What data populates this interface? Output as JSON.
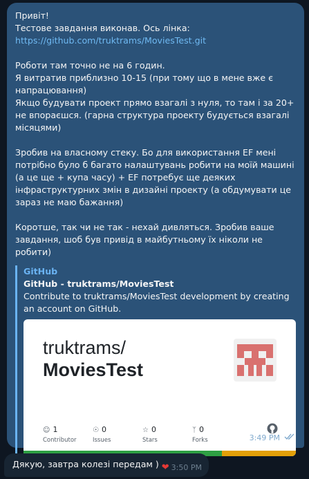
{
  "outgoing_message": {
    "paragraphs": [
      [
        "Привіт!",
        "Тестове завдання виконав. Ось лінка:"
      ],
      [
        "Роботи там точно не на 6 годин.",
        "Я витратив приблизно 10-15  (при тому що в  мене вже є напрацювання)",
        "Якщо будувати проект прямо взагалі з нуля, то там і за 20+ не впораєшся. (гарна структура проекту будується взагалі місяцями)"
      ],
      [
        "Зробив на власному стеку. Бо для використання EF мені потрібно було б багато налаштувань робити на моїй машині (а це ще + купа часу) + EF потребує ще деяких інфраструктурних змін в дизайні проекту (а обдумувати це зараз не маю бажання)"
      ],
      [
        "Коротше, так чи не так - нехай дивляться. Зробив ваше завдання, шоб був привід в майбутньому їх ніколи не робити)"
      ]
    ],
    "link": "https://github.com/truktrams/MoviesTest.git",
    "preview": {
      "site": "GitHub",
      "title": "GitHub - truktrams/MoviesTest",
      "description": "Contribute to truktrams/MoviesTest development by creating an account on GitHub.",
      "card": {
        "owner": "truktrams/",
        "repo": "MoviesTest",
        "stats": [
          {
            "icon": "people-icon",
            "value": "1",
            "label": "Contributor"
          },
          {
            "icon": "issue-icon",
            "value": "0",
            "label": "Issues"
          },
          {
            "icon": "star-icon",
            "value": "0",
            "label": "Stars"
          },
          {
            "icon": "fork-icon",
            "value": "0",
            "label": "Forks"
          }
        ],
        "bar_colors": [
          "#2ea043",
          "#e3a008"
        ],
        "language_split_percent": 73
      }
    },
    "time": "3:49 PM",
    "status": "read"
  },
  "incoming_message": {
    "text": "Дякую, завтра колезі передам )",
    "reaction": "❤",
    "time": "3:50 PM"
  }
}
